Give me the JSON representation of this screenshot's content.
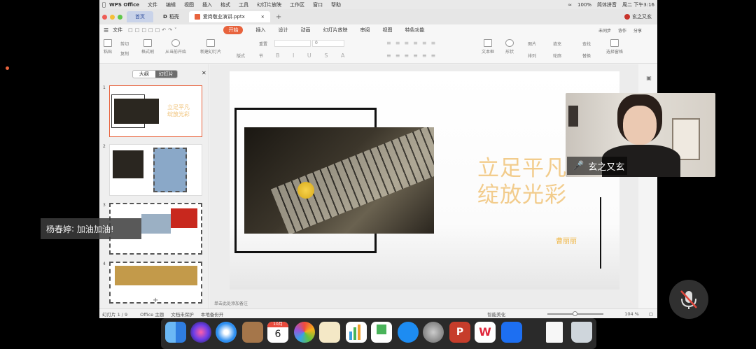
{
  "menubar": {
    "app_name": "WPS Office",
    "menus": [
      "文件",
      "编辑",
      "视图",
      "插入",
      "格式",
      "工具",
      "幻灯片放映",
      "工作区",
      "窗口",
      "帮助"
    ],
    "battery": "100%",
    "input_method": "简体拼音",
    "clock": "周二 下午3:16"
  },
  "tabs": {
    "home": "首页",
    "shell": "稻壳",
    "document": "爱岗敬业演讲.pptx",
    "user": "玄之又玄"
  },
  "ribbon_tabs": {
    "file": "文件",
    "items": [
      "开始",
      "插入",
      "设计",
      "动画",
      "幻灯片放映",
      "审阅",
      "视图",
      "特色功能"
    ],
    "right": [
      "未同步",
      "协作",
      "分享"
    ]
  },
  "ribbon": {
    "paste": "粘贴",
    "cut": "剪切",
    "copy": "复制",
    "format_painter": "格式刷",
    "play_from_current": "从当前开始",
    "new_slide": "新建幻灯片",
    "layout": "版式",
    "reset": "重置",
    "section": "节",
    "font_size": "0",
    "text_box": "文本框",
    "shape": "形状",
    "picture": "图片",
    "arrange": "排列",
    "fill": "填充",
    "outline": "轮廓",
    "find": "查找",
    "replace": "替换",
    "select_pane": "选择窗格"
  },
  "left_panel": {
    "outline_tab": "大纲",
    "slides_tab": "幻灯片",
    "thumbnails": [
      {
        "number": "1",
        "title": "立足平凡",
        "subtitle": "绽放光彩"
      },
      {
        "number": "2"
      },
      {
        "number": "3"
      },
      {
        "number": "4"
      }
    ]
  },
  "slide": {
    "title_line1": "立足平凡",
    "title_line2": "绽放光彩",
    "author": "曹丽丽"
  },
  "notes_placeholder": "单击此处添加备注",
  "statusbar": {
    "slide_counter": "幻灯片 1 / 9",
    "theme": "Office 主题",
    "doc_unprotected": "文档未保护",
    "local_backup": "本地备份开",
    "smart_beautify": "智能美化",
    "zoom": "104 %"
  },
  "meeting": {
    "speaker_name": "玄之又玄",
    "chat_sender": "杨春婷",
    "chat_message": "加油加油!"
  },
  "dock": {
    "calendar_day": "6",
    "calendar_month": "10月"
  },
  "colors": {
    "accent": "#e8633d",
    "slide_title": "#f2cc8c",
    "author": "#f0b84a",
    "home_tab": "#c9d3e9"
  }
}
